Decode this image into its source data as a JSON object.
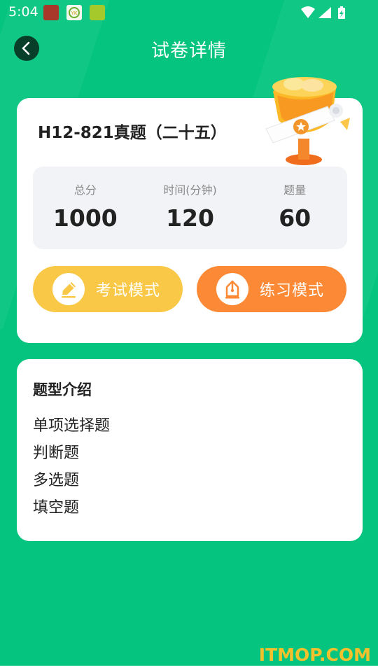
{
  "status_bar": {
    "time": "5:04",
    "icons": [
      "notification-app-1-icon",
      "notification-app-2-icon",
      "notification-app-3-icon",
      "wifi-icon",
      "signal-icon",
      "battery-icon"
    ]
  },
  "header": {
    "title": "试卷详情",
    "back_icon": "chevron-left-icon"
  },
  "exam": {
    "title": "H12-821真题（二十五）",
    "stats": [
      {
        "label": "总分",
        "value": "1000"
      },
      {
        "label": "时间(分钟)",
        "value": "120"
      },
      {
        "label": "题量",
        "value": "60"
      }
    ],
    "modes": {
      "exam_label": "考试模式",
      "exam_icon": "pencil-icon",
      "practice_label": "练习模式",
      "practice_icon": "practice-pen-icon"
    },
    "decoration_icon": "trophy-scroll-icon"
  },
  "intro": {
    "title": "题型介绍",
    "items": [
      "单项选择题",
      "判断题",
      "多选题",
      "填空题"
    ]
  },
  "watermark": "ITMOP.COM",
  "colors": {
    "background": "#05c47f",
    "exam_button": "#f9c846",
    "practice_button": "#fb8935",
    "back_button": "#073f2b"
  }
}
